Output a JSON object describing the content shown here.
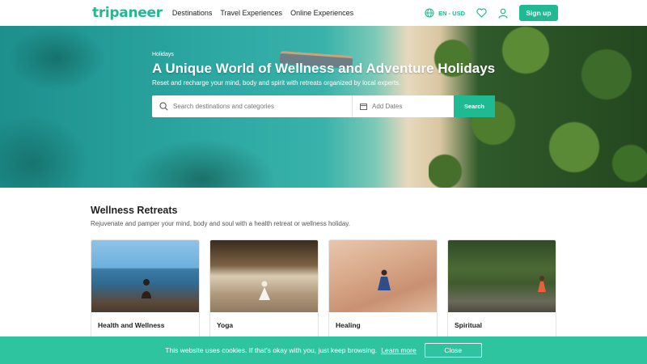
{
  "header": {
    "logo": "tripaneer",
    "nav": [
      "Destinations",
      "Travel Experiences",
      "Online Experiences"
    ],
    "lang": "EN - USD",
    "signup": "Sign up"
  },
  "hero": {
    "breadcrumb": "Holidays",
    "title": "A Unique World of Wellness and Adventure Holidays",
    "subtitle": "Reset and recharge your mind, body and spirit with retreats organized by local experts.",
    "search_placeholder": "Search destinations and categories",
    "dates_placeholder": "Add Dates",
    "search_button": "Search"
  },
  "section": {
    "title": "Wellness Retreats",
    "subtitle": "Rejuvenate and pamper your mind, body and soul with a health retreat or wellness holiday."
  },
  "cards": [
    {
      "label": "Health and Wellness"
    },
    {
      "label": "Yoga"
    },
    {
      "label": "Healing"
    },
    {
      "label": "Spiritual"
    }
  ],
  "cookie": {
    "text": "This website uses cookies. If that's okay with you, just keep browsing.",
    "link": "Learn more",
    "button": "Close"
  },
  "colors": {
    "brand": "#1fba92",
    "cookie_bg": "#2fc4a0"
  }
}
